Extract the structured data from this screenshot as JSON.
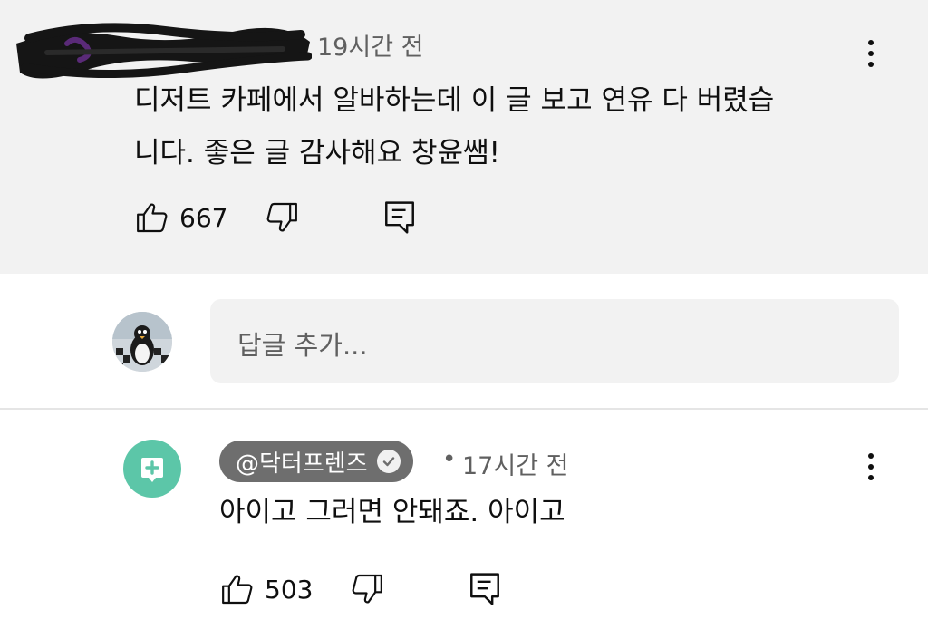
{
  "top_comment": {
    "timestamp": "19시간 전",
    "text_line1": "디저트 카페에서 알바하는데 이 글 보고 연유 다 버렸습",
    "text_line2": "니다. 좋은 글 감사해요 창윤쌤!",
    "like_count": "667",
    "author_redacted": true
  },
  "reply_input": {
    "placeholder": "답글 추가..."
  },
  "reply_comment": {
    "channel_name": "@닥터프렌즈",
    "separator": "•",
    "timestamp": "17시간 전",
    "text": "아이고 그러면 안돼죠. 아이고",
    "like_count": "503",
    "verified": true
  },
  "icons": [
    "thumbs-up-icon",
    "thumbs-down-icon",
    "reply-comment-icon",
    "more-options-icon",
    "verified-check-icon",
    "plus-box-icon"
  ],
  "colors": {
    "highlight_bg": "#f2f2f2",
    "text_primary": "#0f0f0f",
    "text_secondary": "#606060",
    "channel_pill": "#6e6e6e",
    "doctor_avatar": "#5cc6a8",
    "divider": "#e5e5e5"
  }
}
